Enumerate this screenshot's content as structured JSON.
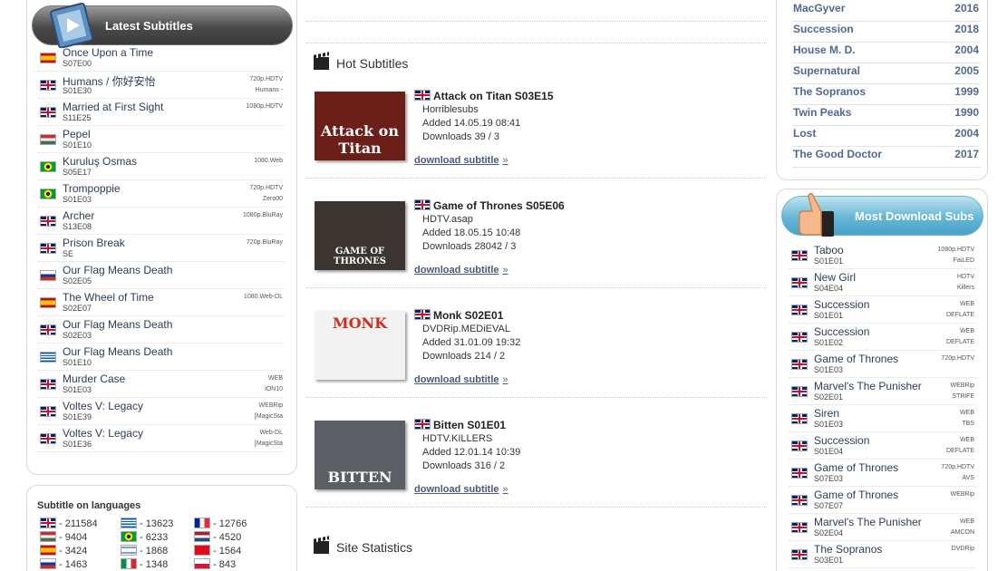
{
  "latest": {
    "title": "Latest Subtitles",
    "items": [
      {
        "flag": "es",
        "title": "Once Upon a Time",
        "ep": "S07E00",
        "q1": "",
        "q2": ""
      },
      {
        "flag": "uk",
        "title": "Humans / 你好安怡",
        "ep": "S01E30",
        "q1": "720p.HDTV",
        "q2": "Humans -"
      },
      {
        "flag": "uk",
        "title": "Married at First Sight",
        "ep": "S11E25",
        "q1": "1080p.HDTV",
        "q2": ""
      },
      {
        "flag": "hu",
        "title": "Pepel",
        "ep": "S01E10",
        "q1": "",
        "q2": ""
      },
      {
        "flag": "br",
        "title": "Kuruluş Osmas",
        "ep": "S05E17",
        "q1": "1080.Web",
        "q2": ""
      },
      {
        "flag": "br",
        "title": "Trompoppie",
        "ep": "S01E03",
        "q1": "720p.HDTV",
        "q2": "Zero00"
      },
      {
        "flag": "uk",
        "title": "Archer",
        "ep": "S13E08",
        "q1": "1080p.BluRay",
        "q2": ""
      },
      {
        "flag": "uk",
        "title": "Prison Break",
        "ep": "SE",
        "q1": "720p.BluRay",
        "q2": ""
      },
      {
        "flag": "ru",
        "title": "Our Flag Means Death",
        "ep": "S02E05",
        "q1": "",
        "q2": ""
      },
      {
        "flag": "es",
        "title": "The Wheel of Time",
        "ep": "S02E07",
        "q1": "1080.Web-DL",
        "q2": ""
      },
      {
        "flag": "uk",
        "title": "Our Flag Means Death",
        "ep": "S02E03",
        "q1": "",
        "q2": ""
      },
      {
        "flag": "gr",
        "title": "Our Flag Means Death",
        "ep": "S01E10",
        "q1": "",
        "q2": ""
      },
      {
        "flag": "uk",
        "title": "Murder Case",
        "ep": "S01E03",
        "q1": "WEB",
        "q2": "iON10"
      },
      {
        "flag": "uk",
        "title": "Voltes V: Legacy",
        "ep": "S01E39",
        "q1": "WEBRip",
        "q2": "[MagicSta"
      },
      {
        "flag": "uk",
        "title": "Voltes V: Legacy",
        "ep": "S01E36",
        "q1": "Web-DL",
        "q2": "[MagicSta"
      }
    ]
  },
  "languages": {
    "title": "Subtitle on languages",
    "items": [
      {
        "flag": "uk",
        "count": "- 211584"
      },
      {
        "flag": "gr",
        "count": "- 13623"
      },
      {
        "flag": "fr",
        "count": "- 12766"
      },
      {
        "flag": "hu",
        "count": "- 9404"
      },
      {
        "flag": "br",
        "count": "- 6233"
      },
      {
        "flag": "nl",
        "count": "- 4520"
      },
      {
        "flag": "es",
        "count": "- 3424"
      },
      {
        "flag": "il",
        "count": "- 1868"
      },
      {
        "flag": "tr",
        "count": "- 1564"
      },
      {
        "flag": "ru",
        "count": "- 1463"
      },
      {
        "flag": "it",
        "count": "- 1348"
      },
      {
        "flag": "pl",
        "count": "- 843"
      }
    ]
  },
  "hot": {
    "title": "Hot Subtitles",
    "link_label": "download subtitle",
    "link_arrow": "»",
    "items": [
      {
        "title": "Attack on Titan S03E15",
        "release": "Horriblesubs",
        "added": "Added 14.05.19 08:41",
        "downloads": "Downloads 39 / 3",
        "poster_text": "Attack on Titan",
        "poster_bg": "#6b1f18"
      },
      {
        "title": "Game of Thrones S05E06",
        "release": "HDTV.asap",
        "added": "Added 18.05.15 10:48",
        "downloads": "Downloads 28042 / 3",
        "poster_text": "GAME OF THRONES",
        "poster_bg": "#3a3530"
      },
      {
        "title": "Monk S02E01",
        "release": "DVDRip.MEDiEVAL",
        "added": "Added 31.01.09 19:32",
        "downloads": "Downloads 214 / 2",
        "poster_text": "MONK",
        "poster_bg": "#f2f2f2"
      },
      {
        "title": "Bitten S01E01",
        "release": "HDTV.KILLERS",
        "added": "Added 12.01.14 10:39",
        "downloads": "Downloads 316 / 2",
        "poster_text": "BITTEN",
        "poster_bg": "#5b5f64"
      }
    ]
  },
  "stats": {
    "title": "Site Statistics"
  },
  "shows": [
    {
      "name": "MacGyver",
      "year": "2016"
    },
    {
      "name": "Succession",
      "year": "2018"
    },
    {
      "name": "House M. D.",
      "year": "2004"
    },
    {
      "name": "Supernatural",
      "year": "2005"
    },
    {
      "name": "The Sopranos",
      "year": "1999"
    },
    {
      "name": "Twin Peaks",
      "year": "1990"
    },
    {
      "name": "Lost",
      "year": "2004"
    },
    {
      "name": "The Good Doctor",
      "year": "2017"
    }
  ],
  "most": {
    "title": "Most Download Subs",
    "items": [
      {
        "flag": "uk",
        "title": "Taboo",
        "ep": "S01E01",
        "q1": "1080p.HDTV",
        "q2": "FaiLED"
      },
      {
        "flag": "uk",
        "title": "New Girl",
        "ep": "S04E04",
        "q1": "HDTV",
        "q2": "Killers"
      },
      {
        "flag": "uk",
        "title": "Succession",
        "ep": "S01E01",
        "q1": "WEB",
        "q2": "DEFLATE"
      },
      {
        "flag": "uk",
        "title": "Succession",
        "ep": "S01E02",
        "q1": "WEB",
        "q2": "DEFLATE"
      },
      {
        "flag": "uk",
        "title": "Game of Thrones",
        "ep": "S01E03",
        "q1": "720p.HDTV",
        "q2": ""
      },
      {
        "flag": "uk",
        "title": "Marvel's The Punisher",
        "ep": "S02E01",
        "q1": "WEBRip",
        "q2": "STRiFE"
      },
      {
        "flag": "uk",
        "title": "Siren",
        "ep": "S01E03",
        "q1": "WEB",
        "q2": "TBS"
      },
      {
        "flag": "uk",
        "title": "Succession",
        "ep": "S01E04",
        "q1": "WEB",
        "q2": "DEFLATE"
      },
      {
        "flag": "uk",
        "title": "Game of Thrones",
        "ep": "S07E03",
        "q1": "720p.HDTV",
        "q2": "AVS"
      },
      {
        "flag": "uk",
        "title": "Game of Thrones",
        "ep": "S07E07",
        "q1": "WEBRip",
        "q2": ""
      },
      {
        "flag": "uk",
        "title": "Marvel's The Punisher",
        "ep": "S02E04",
        "q1": "WEB",
        "q2": "AMCON"
      },
      {
        "flag": "uk",
        "title": "The Sopranos",
        "ep": "S03E01",
        "q1": "DVDRip",
        "q2": ""
      }
    ]
  }
}
